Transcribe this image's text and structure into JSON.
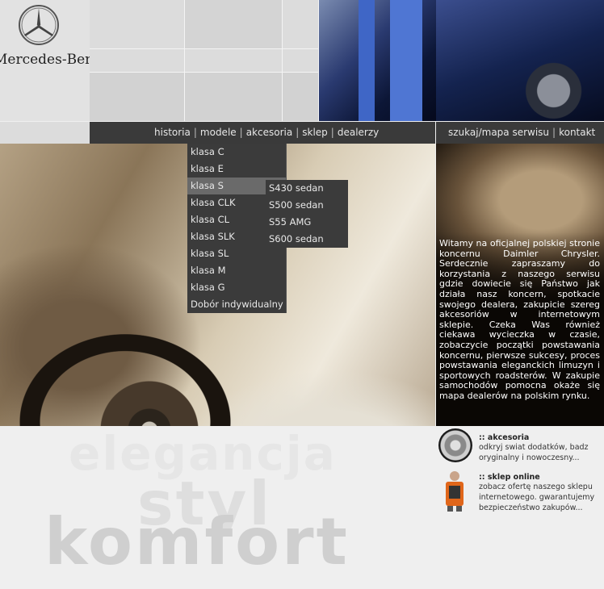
{
  "brand": {
    "name": "Mercedes-Benz",
    "logo_icon": "mercedes-star-icon"
  },
  "nav": {
    "main": [
      "historia",
      "modele",
      "akcesoria",
      "sklep",
      "dealerzy"
    ],
    "secondary": [
      "szukaj/mapa serwisu",
      "kontakt"
    ],
    "separator": "|"
  },
  "models_menu": {
    "items": [
      "klasa C",
      "klasa E",
      "klasa S",
      "klasa CLK",
      "klasa CL",
      "klasa SLK",
      "klasa SL",
      "klasa M",
      "klasa G",
      "Dobór indywidualny"
    ],
    "active": "klasa S"
  },
  "submenu": {
    "items": [
      "S430 sedan",
      "S500 sedan",
      "S55 AMG",
      "S600 sedan"
    ]
  },
  "welcome_text": "Witamy na oficjalnej polskiej stronie koncernu Daimler Chrysler. Serdecznie zapraszamy do korzystania z naszego serwisu gdzie dowiecie się Państwo jak działa nasz koncern, spotkacie swojego dealera, zakupicie szereg akcesoriów w internetowym sklepie. Czeka Was również ciekawa wycieczka w czasie, zobaczycie początki powstawania koncernu, pierwsze sukcesy, proces powstawania eleganckich limuzyn i sportowych roadsterów. W zakupie samochodów pomocna okaże się mapa dealerów na polskim rynku.",
  "tagline": [
    "elegancja",
    "styl",
    "komfort"
  ],
  "promos": [
    {
      "title": ":: akcesoria",
      "text": "odkryj swiat dodatków, badz oryginalny i nowoczesny...",
      "icon": "tire-icon"
    },
    {
      "title": ":: sklep online",
      "text": "zobacz ofertę naszego sklepu internetowego. gwarantujemy bezpieczeństwo zakupów...",
      "icon": "shopping-figure-icon"
    }
  ]
}
